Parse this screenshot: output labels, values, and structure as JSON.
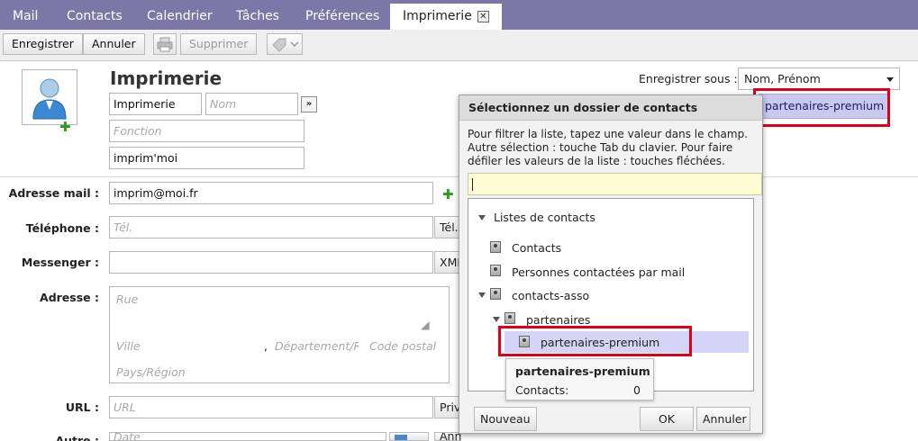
{
  "tabs": [
    {
      "label": "Mail"
    },
    {
      "label": "Contacts"
    },
    {
      "label": "Calendrier"
    },
    {
      "label": "Tâches"
    },
    {
      "label": "Préférences"
    },
    {
      "label": "Imprimerie",
      "active": true
    }
  ],
  "toolbar": {
    "save_label": "Enregistrer",
    "cancel_label": "Annuler",
    "delete_label": "Supprimer"
  },
  "contact": {
    "title": "Imprimerie",
    "first_name": "Imprimerie",
    "last_name_placeholder": "Nom",
    "function_placeholder": "Fonction",
    "company": "imprim'moi",
    "save_as_label": "Enregistrer sous :",
    "save_as_value": "Nom, Prénom",
    "folder_button_label": "partenaires-premium"
  },
  "form": {
    "email_label": "Adresse mail :",
    "email_value": "imprim@moi.fr",
    "phone_label": "Téléphone :",
    "phone_placeholder": "Tél.",
    "phone_type": "Tél.",
    "messenger_label": "Messenger :",
    "messenger_type": "XMPP",
    "address_label": "Adresse :",
    "street_placeholder": "Rue",
    "city_placeholder": "Ville",
    "comma": ",",
    "department_placeholder": "Département/Région",
    "postal_placeholder": "Code postal",
    "country_placeholder": "Pays/Région",
    "url_label": "URL :",
    "url_placeholder": "URL",
    "url_type": "Privé",
    "other_label": "Autre :",
    "date_placeholder": "Date",
    "anniversary": "Anniversaire"
  },
  "dialog": {
    "title": "Sélectionnez un dossier de contacts",
    "help": "Pour filtrer la liste, tapez une valeur dans le champ. Autre sélection : touche Tab du clavier. Pour faire défiler les valeurs de la liste : touches fléchées.",
    "tree": {
      "root": "Listes de contacts",
      "item1": "Contacts",
      "item2": "Personnes contactées par mail",
      "item3": "contacts-asso",
      "item4": "partenaires",
      "item5": "partenaires-premium"
    },
    "tooltip": {
      "title": "partenaires-premium",
      "contacts_label": "Contacts:",
      "contacts_value": "0"
    },
    "new_label": "Nouveau",
    "ok_label": "OK",
    "cancel_label": "Annuler"
  },
  "colors": {
    "tabbar": "#7d77a8",
    "highlight": "#e00016",
    "selected_row": "#d4d4f6"
  }
}
